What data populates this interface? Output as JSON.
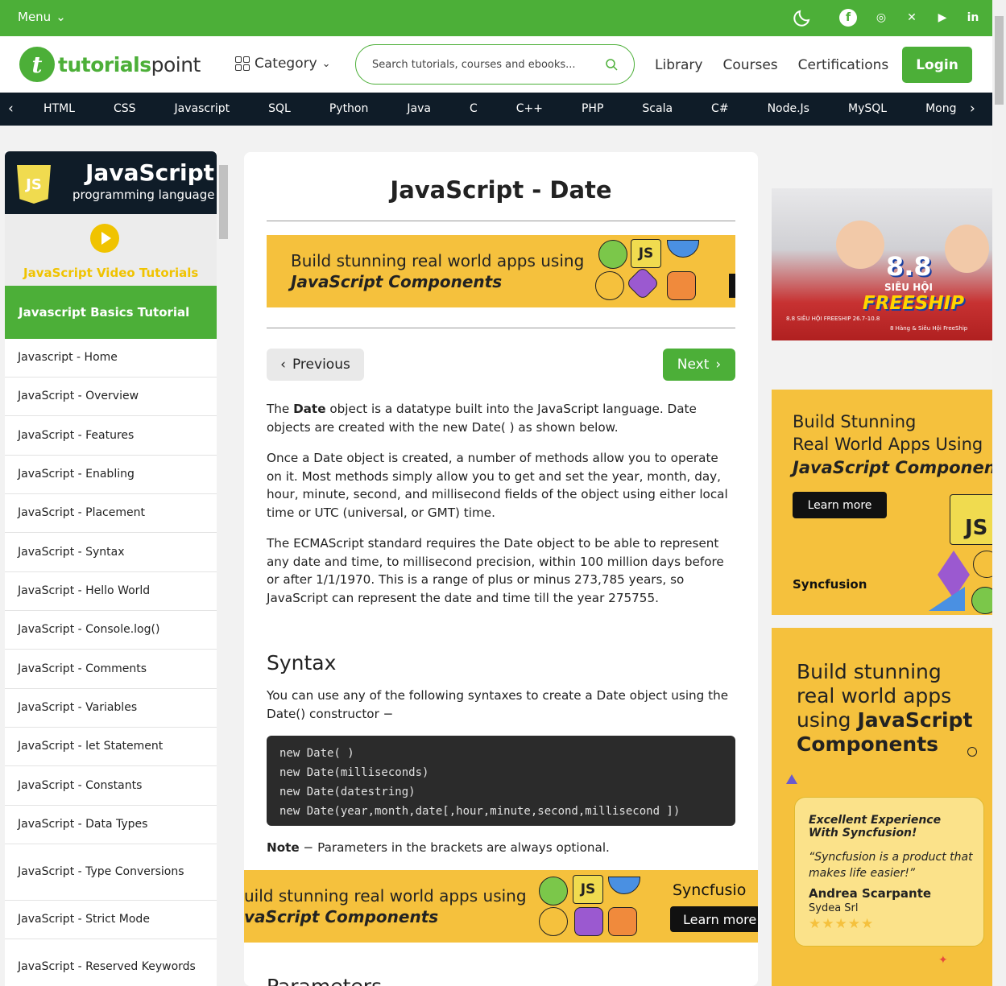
{
  "topbar": {
    "menu_label": "Menu",
    "social": [
      "facebook-icon",
      "instagram-icon",
      "x-icon",
      "youtube-icon",
      "linkedin-icon"
    ]
  },
  "header": {
    "logo_text_a": "tutorials",
    "logo_text_b": "point",
    "category_label": "Category",
    "search_placeholder": "Search tutorials, courses and ebooks...",
    "nav": [
      "Library",
      "Courses",
      "Certifications"
    ],
    "login_label": "Login"
  },
  "langbar": {
    "items": [
      "HTML",
      "CSS",
      "Javascript",
      "SQL",
      "Python",
      "Java",
      "C",
      "C++",
      "PHP",
      "Scala",
      "C#",
      "Node.Js",
      "MySQL",
      "Mong"
    ]
  },
  "sidebar": {
    "title": "JavaScript",
    "subtitle": "programming language",
    "shield_text": "JS",
    "video_label": "JavaScript Video Tutorials",
    "section_label": "Javascript Basics Tutorial",
    "items": [
      "Javascript - Home",
      "JavaScript - Overview",
      "JavaScript - Features",
      "JavaScript - Enabling",
      "JavaScript - Placement",
      "JavaScript - Syntax",
      "JavaScript - Hello World",
      "JavaScript - Console.log()",
      "JavaScript - Comments",
      "JavaScript - Variables",
      "JavaScript - let Statement",
      "JavaScript - Constants",
      "JavaScript - Data Types",
      "JavaScript - Type Conversions",
      "JavaScript - Strict Mode",
      "JavaScript - Reserved Keywords"
    ]
  },
  "main": {
    "title": "JavaScript - Date",
    "banner1": {
      "line1": "Build stunning real world apps using",
      "line2": "JavaScript Components",
      "tile": "JS"
    },
    "prev_label": "Previous",
    "next_label": "Next",
    "p1_pre": "The ",
    "p1_bold": "Date",
    "p1_post": " object is a datatype built into the JavaScript language. Date objects are created with the new Date( ) as shown below.",
    "p2": "Once a Date object is created, a number of methods allow you to operate on it. Most methods simply allow you to get and set the year, month, day, hour, minute, second, and millisecond fields of the object using either local time or UTC (universal, or GMT) time.",
    "p3": "The ECMAScript standard requires the Date object to be able to represent any date and time, to millisecond precision, within 100 million days before or after 1/1/1970. This is a range of plus or minus 273,785 years, so JavaScript can represent the date and time till the year 275755.",
    "syntax_heading": "Syntax",
    "syntax_intro": "You can use any of the following syntaxes to create a Date object using the Date() constructor −",
    "code_lines": [
      "new Date( )",
      "new Date(milliseconds)",
      "new Date(datestring)",
      "new Date(year,month,date[,hour,minute,second,millisecond ])"
    ],
    "note_bold": "Note",
    "note_text": " − Parameters in the brackets are always optional.",
    "banner2": {
      "line1": "uild stunning real world apps using",
      "line2": "vaScript Components",
      "tile": "JS",
      "brand": "Syncfusio",
      "cta": "Learn more"
    },
    "params_heading": "Parameters"
  },
  "right_ads": {
    "ad1": {
      "badge": "8.8",
      "line1": "SIÊU HỘI",
      "line2": "FREESHIP",
      "footer": "8.8 SIÊU HỘI FREESHIP 26.7-10.8",
      "footer2": "8 Hàng & Siêu Hội FreeShip"
    },
    "ad2": {
      "line1": "Build Stunning",
      "line2": "Real World Apps Using",
      "line3": "JavaScript Components",
      "cta": "Learn more",
      "brand": "Syncfusion",
      "tile": "JS"
    },
    "ad3": {
      "line1": "Build stunning",
      "line2": "real world apps",
      "line3a": "using ",
      "line3b": "JavaScript",
      "line4": "Components",
      "quote_title1": "Excellent Experience",
      "quote_title2": "With Syncfusion!",
      "quote_text": "“Syncfusion is a product that makes life easier!”",
      "author": "Andrea Scarpante",
      "company": "Sydea Srl",
      "stars": "★★★★★"
    }
  },
  "colors": {
    "brand_green": "#4caf38",
    "dark_navy": "#0f1c28",
    "ad_yellow": "#f5c13d"
  }
}
